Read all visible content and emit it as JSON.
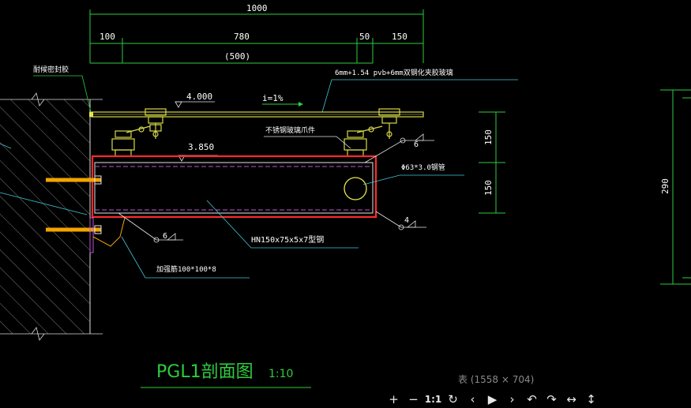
{
  "drawing": {
    "dims": {
      "total": "1000",
      "seg_left": "100",
      "seg_mid": "780",
      "seg_small": "50",
      "seg_right": "150",
      "sub": "(500)",
      "v_upper": "150",
      "v_lower": "150",
      "right_total": "290"
    },
    "labels": {
      "seal": "耐候密封胶",
      "glass": "6mm+1.54 pvb+6mm双钢化夹胶玻璃",
      "elev_top": "4.000",
      "slope": "i=1%",
      "clip": "不锈钢玻璃爪件",
      "elev_mid": "3.850",
      "pipe": "Φ63*3.0钢管",
      "beam": "HN150x75x5x7型钢",
      "plate": "加强筋100*100*8"
    },
    "welds": {
      "w_pipe": "6",
      "w_pipe_top": "4",
      "w_plate": "6"
    },
    "title": "PGL1剖面图",
    "scale": "1:10"
  },
  "viewer": {
    "caption": "表 (1558 × 704)",
    "toolbar": {
      "zoom_in": "+",
      "zoom_out": "−",
      "actual_size": "1:1",
      "rotate": "↻",
      "prev": "‹",
      "play": "▶",
      "next": "›",
      "undo": "↶",
      "redo": "↷",
      "fit_width": "↔",
      "fit_height": "↕"
    }
  }
}
